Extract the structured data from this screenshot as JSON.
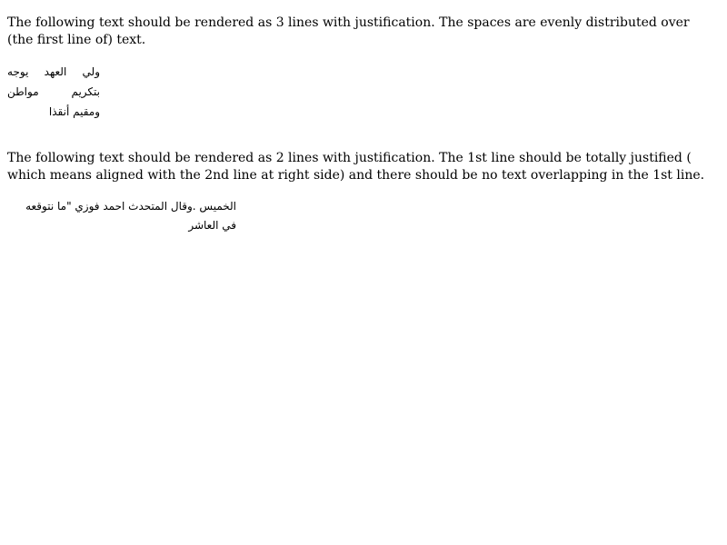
{
  "section1": {
    "description": "The following text should be rendered as 3 lines with justification. The spaces are evenly distributed over (the first line of) text.",
    "arabic_line1_words": [
      "ولي",
      "العهد",
      "يوجه"
    ],
    "arabic_line2_words": [
      "بتكريم",
      "مواطن"
    ],
    "arabic_line3": "ومقيم أنقذا"
  },
  "section2": {
    "description": "The following text should be rendered as 2 lines with justification. The 1st line should be totally justified ( which means aligned with the 2nd line at right side) and there should be no text overlapping in the 1st line.",
    "arabic_line1": "الخميس .وقال المتحدث احمد فوزي \"ما نتوقعه",
    "arabic_line2": "في العاشر"
  }
}
